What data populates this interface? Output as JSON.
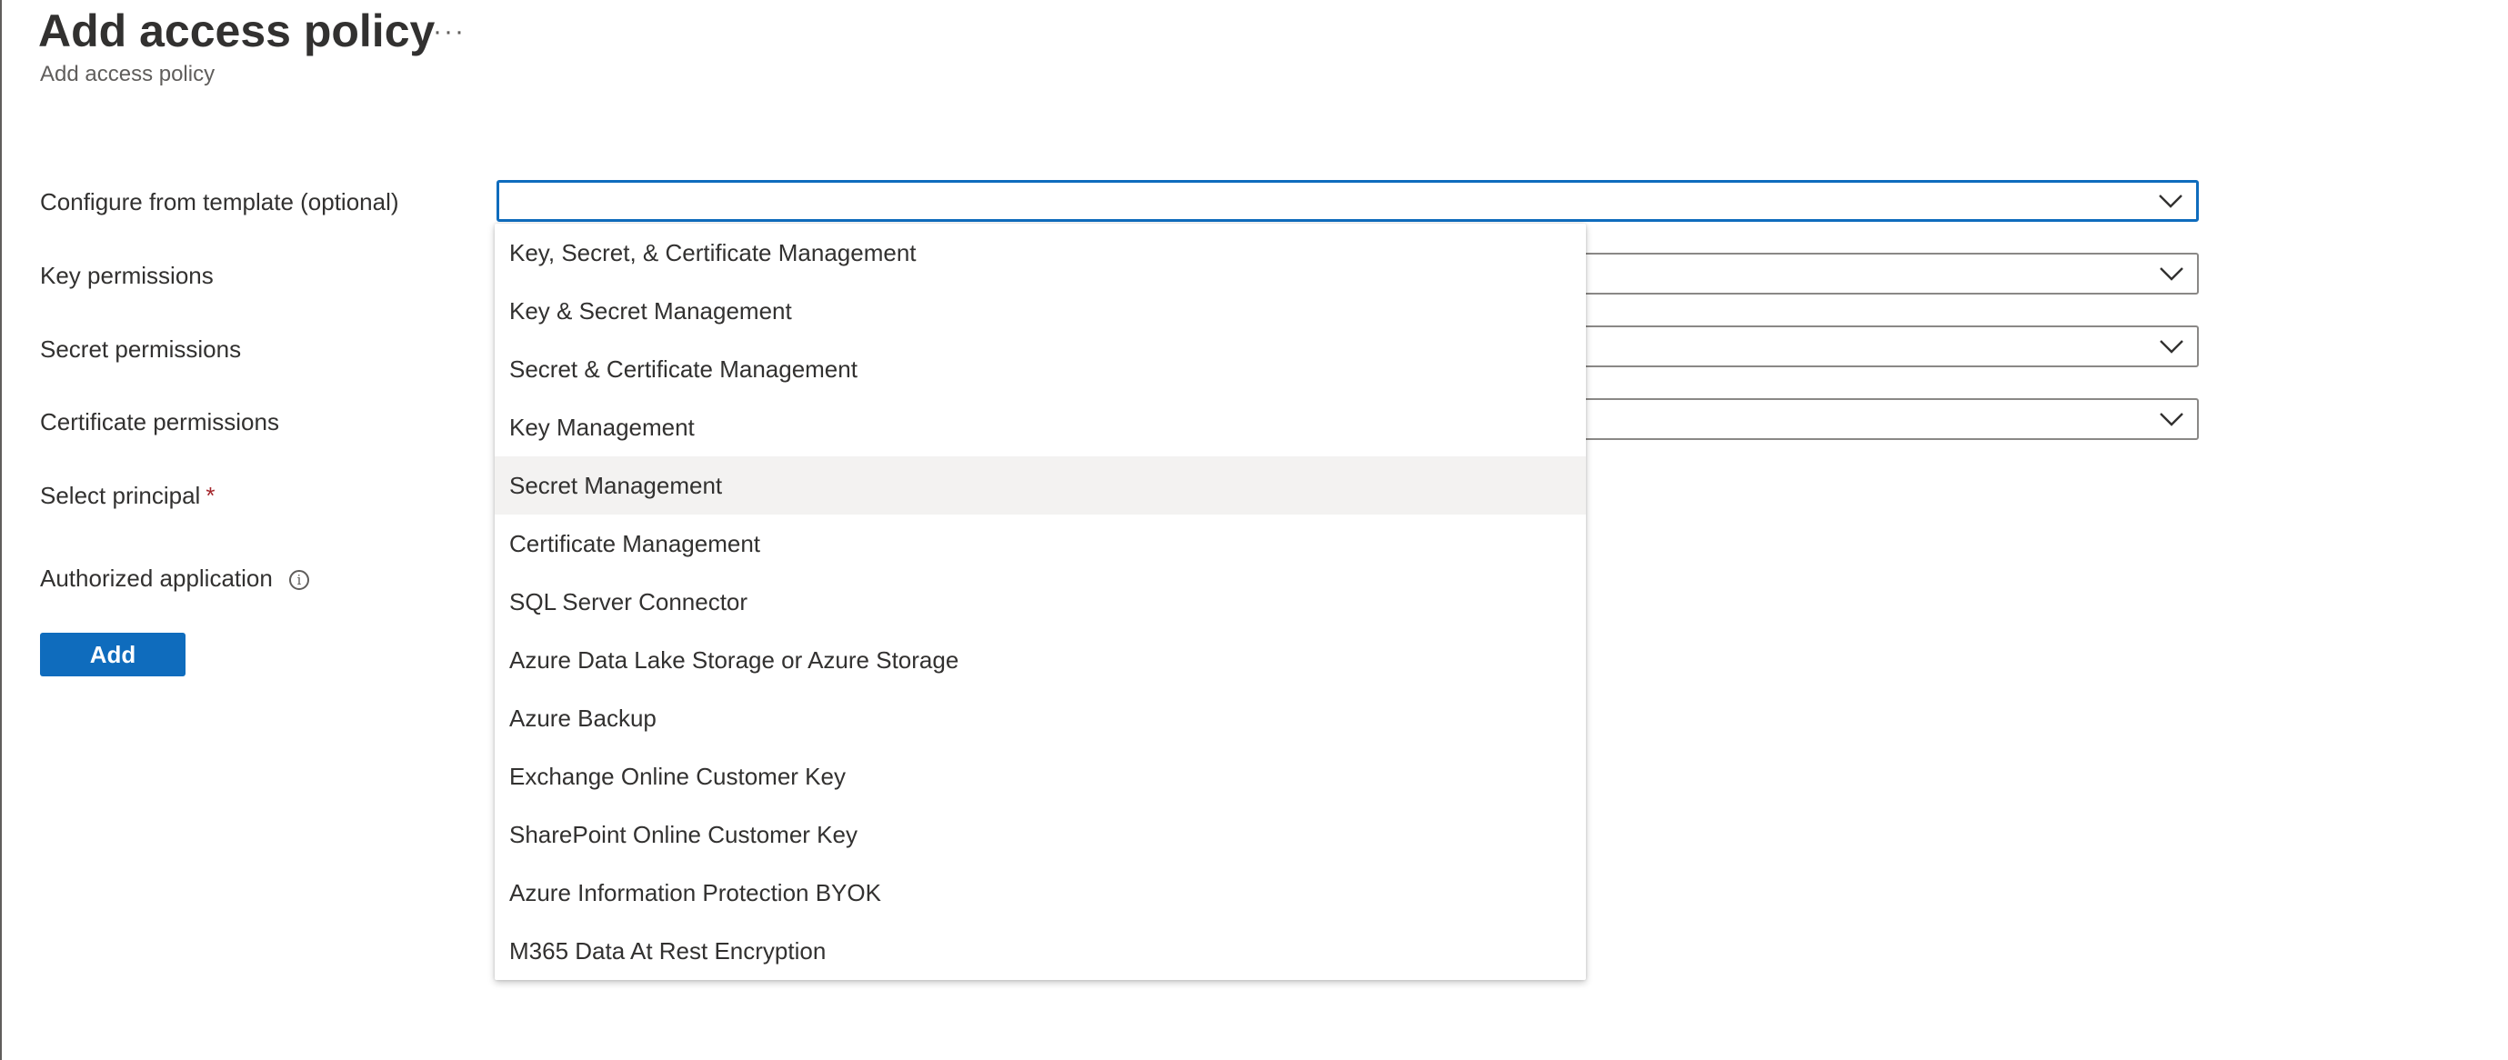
{
  "header": {
    "title": "Add access policy",
    "more_label": "···",
    "subtitle": "Add access policy"
  },
  "form": {
    "template_label": "Configure from template (optional)",
    "template_value": "",
    "key_label": "Key permissions",
    "secret_label": "Secret permissions",
    "certificate_label": "Certificate permissions",
    "principal_label": "Select principal",
    "required_mark": "*",
    "authorized_app_label": "Authorized application",
    "info_glyph": "i",
    "add_label": "Add"
  },
  "dropdown": {
    "highlighted_index": 4,
    "options": [
      "Key, Secret, & Certificate Management",
      "Key & Secret Management",
      "Secret & Certificate Management",
      "Key Management",
      "Secret Management",
      "Certificate Management",
      "SQL Server Connector",
      "Azure Data Lake Storage or Azure Storage",
      "Azure Backup",
      "Exchange Online Customer Key",
      "SharePoint Online Customer Key",
      "Azure Information Protection BYOK",
      "M365 Data At Rest Encryption"
    ]
  },
  "colors": {
    "accent": "#0f6cbd",
    "required": "#a4262c",
    "hover": "#f3f2f1"
  },
  "icons": {
    "dropdown": "chevron-down-icon",
    "info": "info-icon",
    "more": "more-icon"
  }
}
